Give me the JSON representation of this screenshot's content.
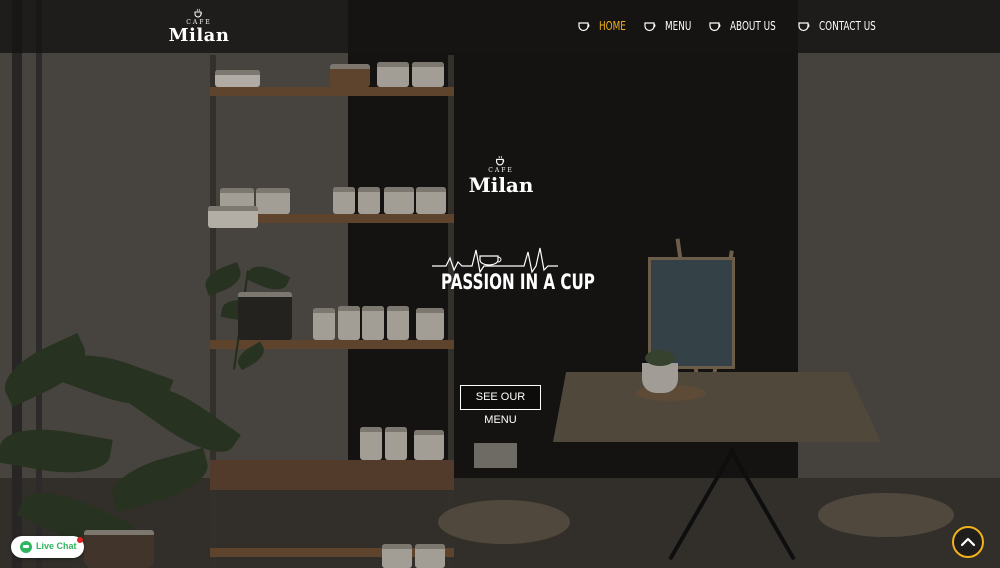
{
  "colors": {
    "accent": "#f2b21c",
    "header_bg": "#161514",
    "chat_green": "#2fb55f",
    "chat_badge": "#e02424"
  },
  "header": {
    "logo": {
      "cafe": "CAFE",
      "name": "Milan",
      "icon": "coffee-cup-icon"
    },
    "nav": [
      {
        "label": "HOME",
        "active": true,
        "icon": "coffee-cup-icon"
      },
      {
        "label": "MENU",
        "active": false,
        "icon": "coffee-cup-icon"
      },
      {
        "label": "ABOUT US",
        "active": false,
        "icon": "coffee-cup-icon"
      },
      {
        "label": "CONTACT US",
        "active": false,
        "icon": "coffee-cup-icon"
      }
    ]
  },
  "hero": {
    "logo": {
      "cafe": "CAFE",
      "name": "Milan"
    },
    "tagline": "PASSION IN A CUP",
    "cta_label": "SEE OUR MENU"
  },
  "widgets": {
    "scroll_top_icon": "chevron-up-icon",
    "chat_label": "Live Chat",
    "chat_icon": "chat-bubble-icon"
  }
}
